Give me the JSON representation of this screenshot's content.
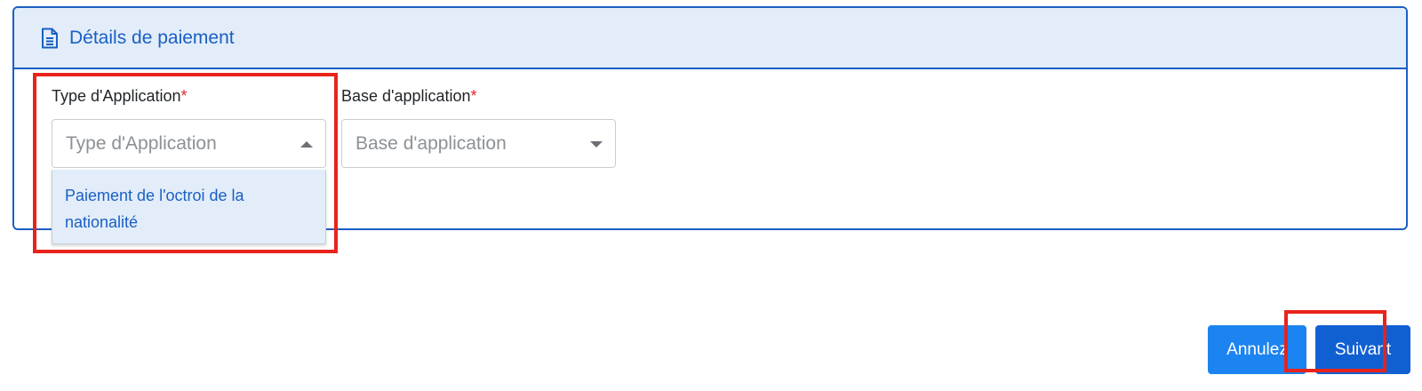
{
  "card": {
    "title": "Détails de paiement",
    "icon": "document-icon"
  },
  "fields": {
    "type_application": {
      "label": "Type d'Application",
      "required_marker": "*",
      "placeholder": "Type d'Application",
      "state": "open",
      "options": [
        "Paiement de l'octroi de la nationalité"
      ]
    },
    "base_application": {
      "label": "Base d'application",
      "required_marker": "*",
      "placeholder": "Base d'application",
      "state": "closed"
    }
  },
  "buttons": {
    "cancel": "Annulez",
    "next": "Suivant"
  },
  "colors": {
    "accent": "#1a5fc4",
    "header_bg": "#e2edf9",
    "highlight": "#e8231b",
    "cancel_bg": "#1b84f0",
    "next_bg": "#1060d2"
  }
}
